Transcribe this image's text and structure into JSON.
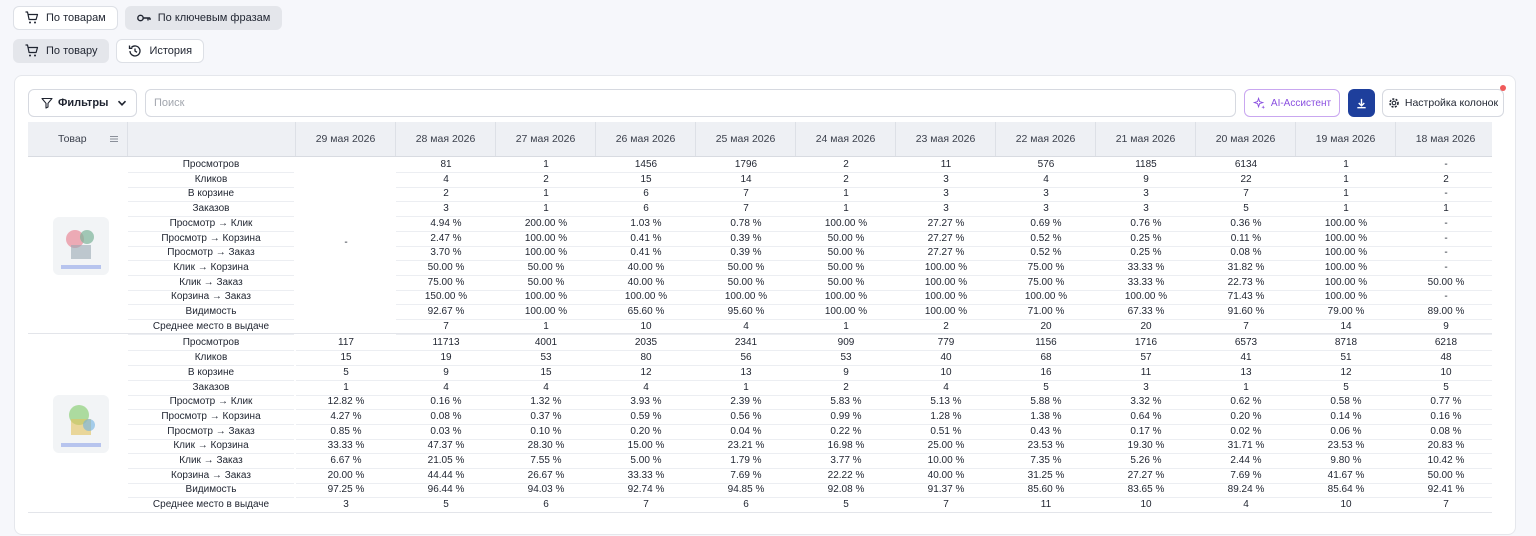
{
  "top_tabs": [
    {
      "label": "По товарам",
      "icon": "cart-icon",
      "active": false
    },
    {
      "label": "По ключевым фразам",
      "icon": "key-icon",
      "active": true
    }
  ],
  "sub_tabs": [
    {
      "label": "По товару",
      "icon": "cart-icon",
      "active": true
    },
    {
      "label": "История",
      "icon": "history-icon",
      "active": false
    }
  ],
  "toolbar": {
    "filters_label": "Фильтры",
    "search_placeholder": "Поиск",
    "ai_label": "AI-Ассистент",
    "columns_label": "Настройка колонок"
  },
  "colors": {
    "accent": "#1e3f9c",
    "ai": "#8a4fe0",
    "notification": "#f05a5a"
  },
  "table": {
    "product_header": "Товар",
    "dates": [
      "29 мая 2026",
      "28 мая 2026",
      "27 мая 2026",
      "26 мая 2026",
      "25 мая 2026",
      "24 мая 2026",
      "23 мая 2026",
      "22 мая 2026",
      "21 мая 2026",
      "20 мая 2026",
      "19 мая 2026",
      "18 мая 2026"
    ],
    "metrics": [
      "Просмотров",
      "Кликов",
      "В корзине",
      "Заказов",
      "Просмотр → Клик",
      "Просмотр → Корзина",
      "Просмотр → Заказ",
      "Клик → Корзина",
      "Клик → Заказ",
      "Корзина → Заказ",
      "Видимость",
      "Среднее место в выдаче"
    ],
    "products": [
      {
        "first_day_merged": "-",
        "values": [
          [
            "81",
            "1",
            "1456",
            "1796",
            "2",
            "11",
            "576",
            "1185",
            "6134",
            "1",
            "-"
          ],
          [
            "4",
            "2",
            "15",
            "14",
            "2",
            "3",
            "4",
            "9",
            "22",
            "1",
            "2"
          ],
          [
            "2",
            "1",
            "6",
            "7",
            "1",
            "3",
            "3",
            "3",
            "7",
            "1",
            "-"
          ],
          [
            "3",
            "1",
            "6",
            "7",
            "1",
            "3",
            "3",
            "3",
            "5",
            "1",
            "1"
          ],
          [
            "4.94 %",
            "200.00 %",
            "1.03 %",
            "0.78 %",
            "100.00 %",
            "27.27 %",
            "0.69 %",
            "0.76 %",
            "0.36 %",
            "100.00 %",
            "-"
          ],
          [
            "2.47 %",
            "100.00 %",
            "0.41 %",
            "0.39 %",
            "50.00 %",
            "27.27 %",
            "0.52 %",
            "0.25 %",
            "0.11 %",
            "100.00 %",
            "-"
          ],
          [
            "3.70 %",
            "100.00 %",
            "0.41 %",
            "0.39 %",
            "50.00 %",
            "27.27 %",
            "0.52 %",
            "0.25 %",
            "0.08 %",
            "100.00 %",
            "-"
          ],
          [
            "50.00 %",
            "50.00 %",
            "40.00 %",
            "50.00 %",
            "50.00 %",
            "100.00 %",
            "75.00 %",
            "33.33 %",
            "31.82 %",
            "100.00 %",
            "-"
          ],
          [
            "75.00 %",
            "50.00 %",
            "40.00 %",
            "50.00 %",
            "50.00 %",
            "100.00 %",
            "75.00 %",
            "33.33 %",
            "22.73 %",
            "100.00 %",
            "50.00 %"
          ],
          [
            "150.00 %",
            "100.00 %",
            "100.00 %",
            "100.00 %",
            "100.00 %",
            "100.00 %",
            "100.00 %",
            "100.00 %",
            "71.43 %",
            "100.00 %",
            "-"
          ],
          [
            "92.67 %",
            "100.00 %",
            "65.60 %",
            "95.60 %",
            "100.00 %",
            "100.00 %",
            "71.00 %",
            "67.33 %",
            "91.60 %",
            "79.00 %",
            "89.00 %"
          ],
          [
            "7",
            "1",
            "10",
            "4",
            "1",
            "2",
            "20",
            "20",
            "7",
            "14",
            "9"
          ]
        ]
      },
      {
        "values": [
          [
            "117",
            "11713",
            "4001",
            "2035",
            "2341",
            "909",
            "779",
            "1156",
            "1716",
            "6573",
            "8718",
            "6218"
          ],
          [
            "15",
            "19",
            "53",
            "80",
            "56",
            "53",
            "40",
            "68",
            "57",
            "41",
            "51",
            "48"
          ],
          [
            "5",
            "9",
            "15",
            "12",
            "13",
            "9",
            "10",
            "16",
            "11",
            "13",
            "12",
            "10"
          ],
          [
            "1",
            "4",
            "4",
            "4",
            "1",
            "2",
            "4",
            "5",
            "3",
            "1",
            "5",
            "5"
          ],
          [
            "12.82 %",
            "0.16 %",
            "1.32 %",
            "3.93 %",
            "2.39 %",
            "5.83 %",
            "5.13 %",
            "5.88 %",
            "3.32 %",
            "0.62 %",
            "0.58 %",
            "0.77 %"
          ],
          [
            "4.27 %",
            "0.08 %",
            "0.37 %",
            "0.59 %",
            "0.56 %",
            "0.99 %",
            "1.28 %",
            "1.38 %",
            "0.64 %",
            "0.20 %",
            "0.14 %",
            "0.16 %"
          ],
          [
            "0.85 %",
            "0.03 %",
            "0.10 %",
            "0.20 %",
            "0.04 %",
            "0.22 %",
            "0.51 %",
            "0.43 %",
            "0.17 %",
            "0.02 %",
            "0.06 %",
            "0.08 %"
          ],
          [
            "33.33 %",
            "47.37 %",
            "28.30 %",
            "15.00 %",
            "23.21 %",
            "16.98 %",
            "25.00 %",
            "23.53 %",
            "19.30 %",
            "31.71 %",
            "23.53 %",
            "20.83 %"
          ],
          [
            "6.67 %",
            "21.05 %",
            "7.55 %",
            "5.00 %",
            "1.79 %",
            "3.77 %",
            "10.00 %",
            "7.35 %",
            "5.26 %",
            "2.44 %",
            "9.80 %",
            "10.42 %"
          ],
          [
            "20.00 %",
            "44.44 %",
            "26.67 %",
            "33.33 %",
            "7.69 %",
            "22.22 %",
            "40.00 %",
            "31.25 %",
            "27.27 %",
            "7.69 %",
            "41.67 %",
            "50.00 %"
          ],
          [
            "97.25 %",
            "96.44 %",
            "94.03 %",
            "92.74 %",
            "94.85 %",
            "92.08 %",
            "91.37 %",
            "85.60 %",
            "83.65 %",
            "89.24 %",
            "85.64 %",
            "92.41 %"
          ],
          [
            "3",
            "5",
            "6",
            "7",
            "6",
            "5",
            "7",
            "11",
            "10",
            "4",
            "10",
            "7"
          ]
        ]
      }
    ]
  }
}
